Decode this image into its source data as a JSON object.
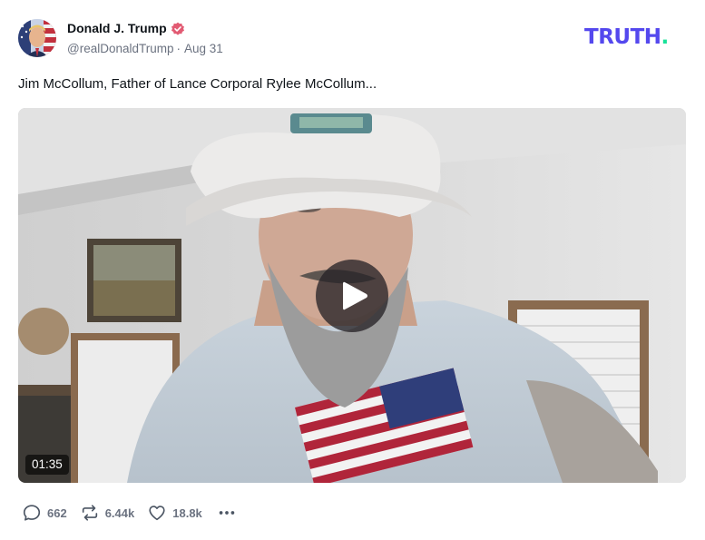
{
  "post": {
    "author": {
      "name": "Donald J. Trump",
      "handle": "@realDonaldTrump",
      "verified_icon": "verified-badge-icon"
    },
    "date": "Aug 31",
    "separator": "·",
    "text": "Jim McCollum, Father of Lance Corporal Rylee McCollum...",
    "video": {
      "duration": "01:35",
      "play_icon": "play-icon"
    },
    "actions": {
      "replies": {
        "icon": "reply-icon",
        "count": "662"
      },
      "retruths": {
        "icon": "retruth-icon",
        "count": "6.44k"
      },
      "likes": {
        "icon": "heart-icon",
        "count": "18.8k"
      },
      "more": {
        "icon": "more-icon"
      }
    }
  },
  "brand": {
    "logo_text": "TRUTH",
    "logo_dot": ".",
    "logo_color": "#5448ee",
    "dot_color": "#18e299"
  },
  "colors": {
    "verified": "#e25b73",
    "muted_text": "#6b7280",
    "primary_text": "#0f1419"
  }
}
